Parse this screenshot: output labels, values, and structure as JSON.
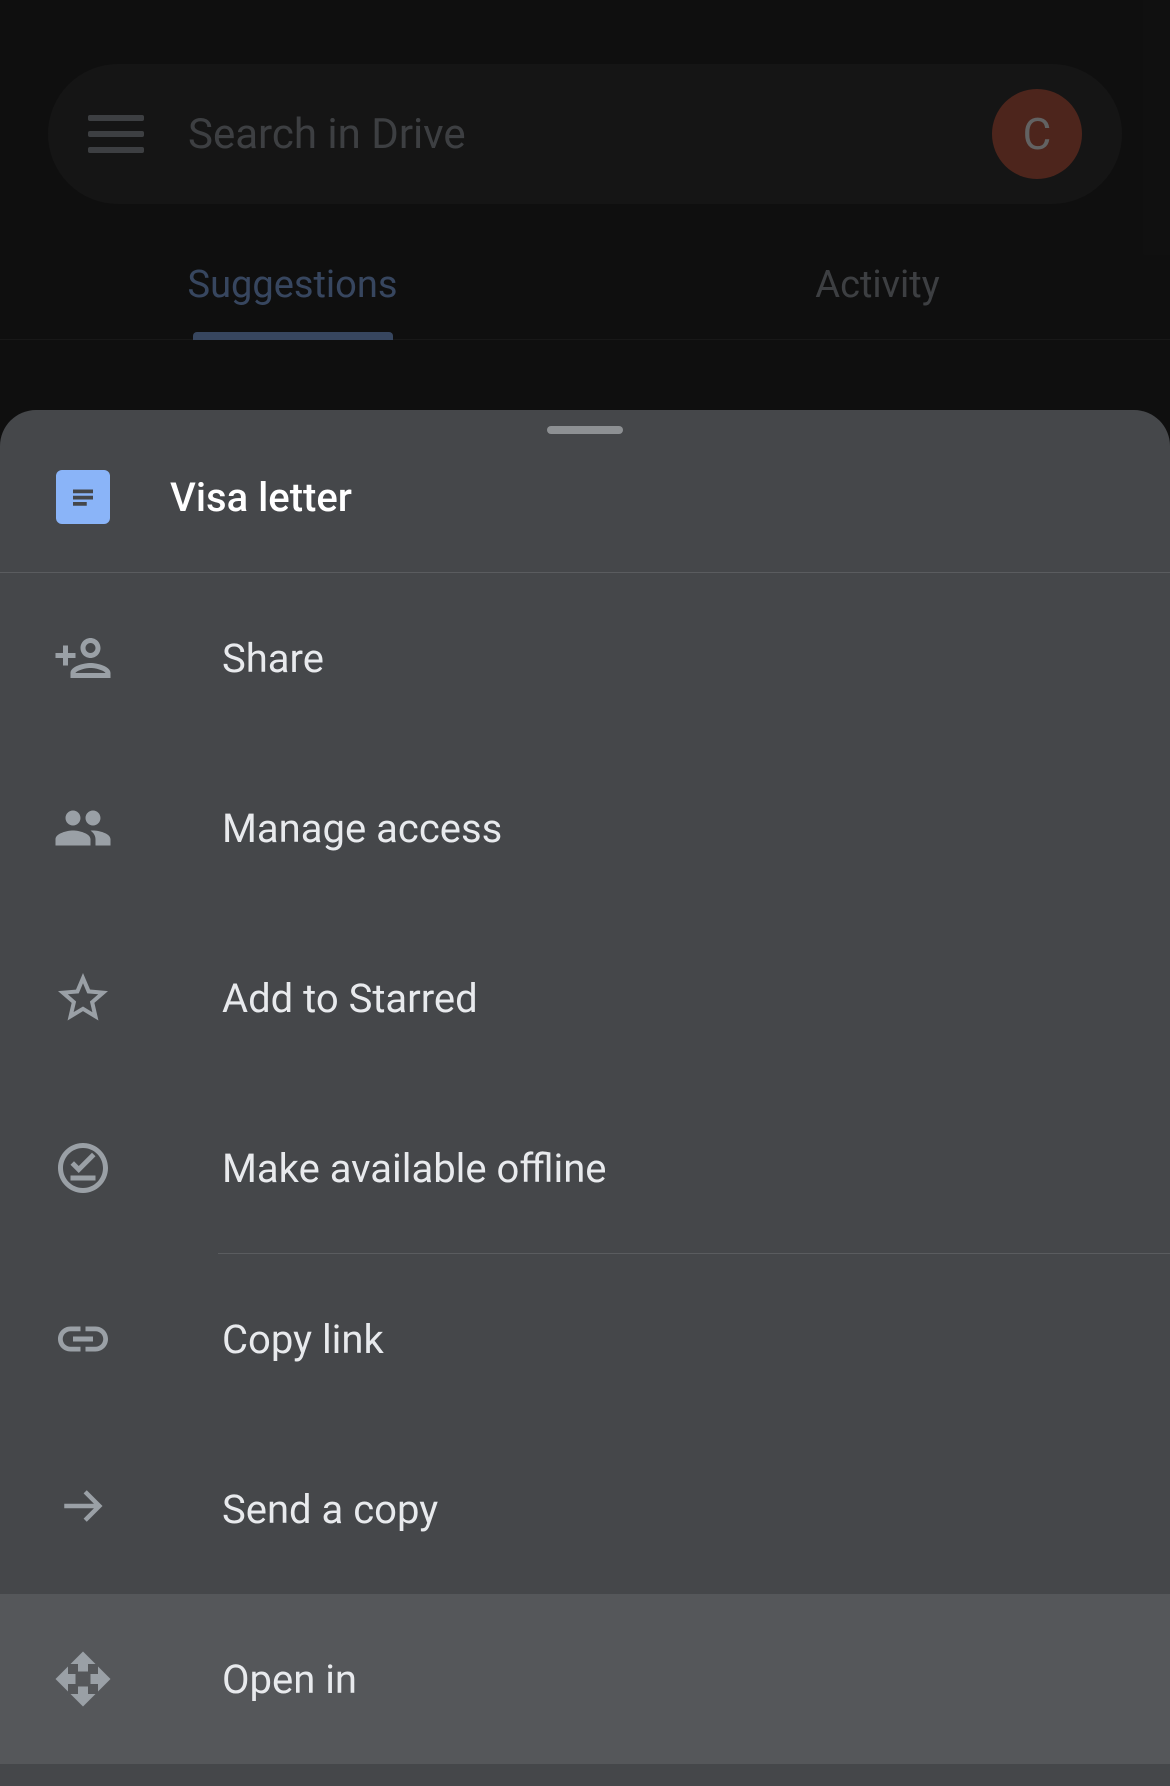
{
  "search": {
    "placeholder": "Search in Drive"
  },
  "avatar": {
    "initial": "C",
    "color": "#c5563d"
  },
  "tabs": {
    "suggestions": "Suggestions",
    "activity": "Activity"
  },
  "sheet": {
    "file_name": "Visa letter",
    "items": {
      "share": "Share",
      "manage_access": "Manage access",
      "add_to_starred": "Add to Starred",
      "make_available_offline": "Make available offline",
      "copy_link": "Copy link",
      "send_a_copy": "Send a copy",
      "open_in": "Open in"
    }
  }
}
